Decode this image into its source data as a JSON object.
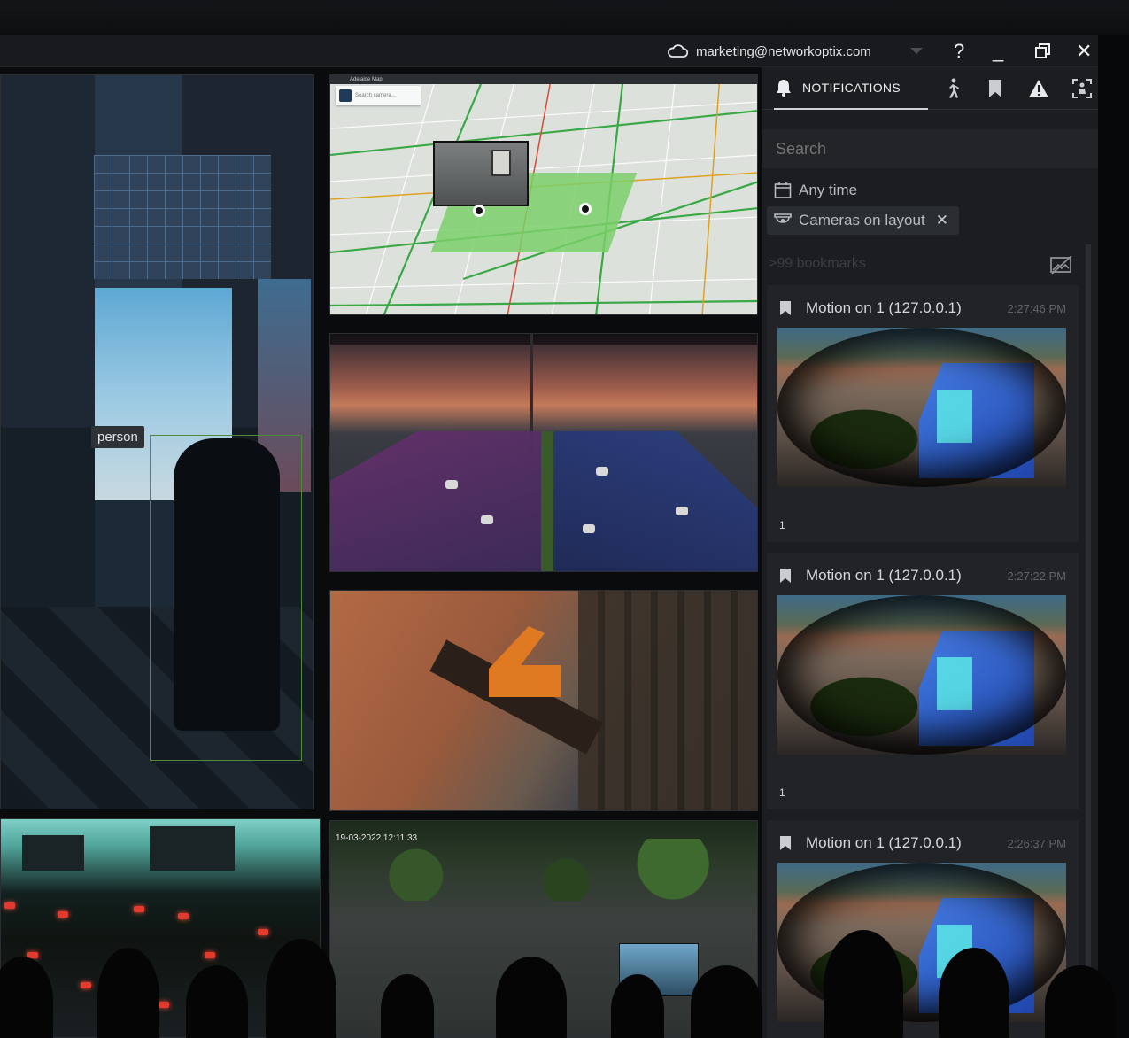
{
  "titlebar": {
    "account": "marketing@networkoptix.com",
    "help": "?",
    "minimize": "_",
    "restore": "⧉",
    "close": "✕"
  },
  "tiles": {
    "airport": {
      "object_label": "person"
    },
    "lot": {
      "timestamp": "19-03-2022 12:11:33"
    }
  },
  "map": {
    "title": "Adelaide Map",
    "search_placeholder": "Search camera..."
  },
  "panel": {
    "tabs": {
      "notifications": "NOTIFICATIONS"
    },
    "search": {
      "placeholder": "Search"
    },
    "filters": {
      "time": "Any time",
      "cameras": "Cameras on layout",
      "cameras_close": "✕"
    },
    "bookmarks_count": ">99 bookmarks",
    "cards": [
      {
        "title": "Motion on 1 (127.0.0.1)",
        "time": "2:27:46 PM",
        "count": "1"
      },
      {
        "title": "Motion on 1 (127.0.0.1)",
        "time": "2:27:22 PM",
        "count": "1"
      },
      {
        "title": "Motion on 1 (127.0.0.1)",
        "time": "2:26:37 PM"
      }
    ]
  },
  "icons": {
    "account": "cloud-icon",
    "notifications": "bell-icon",
    "motion": "walking-person-icon",
    "bookmarks": "bookmark-icon",
    "events": "warning-icon",
    "objects": "person-frame-icon",
    "calendar": "calendar-icon",
    "camera": "camera-icon",
    "bookmark_card": "bookmark-icon"
  },
  "colors": {
    "panel_bg": "#1b1d20",
    "card_bg": "#212327",
    "detection_box": "#4f8a3b"
  }
}
